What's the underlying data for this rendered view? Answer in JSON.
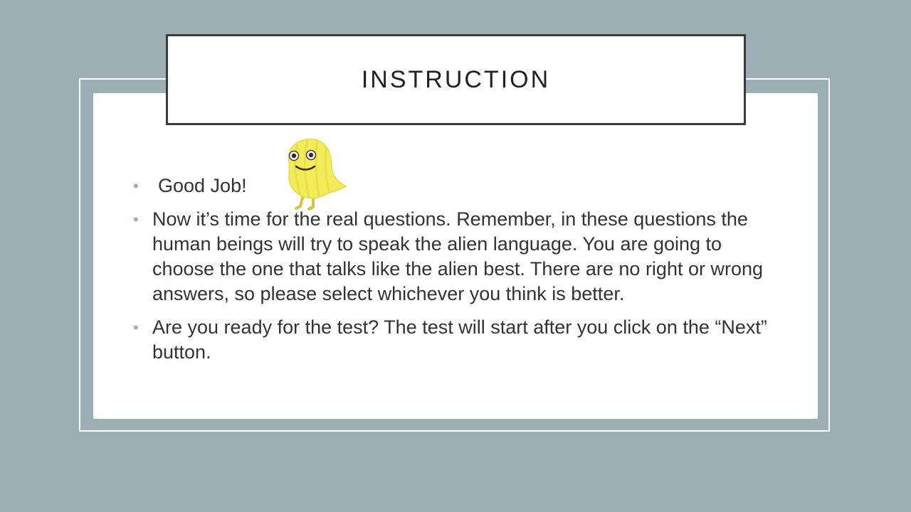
{
  "slide": {
    "title": "INSTRUCTION",
    "bullets": [
      " Good Job!",
      "Now it’s time for the real questions. Remember, in these questions the human beings will try to speak the alien language. You are going to choose the one that talks like the alien best.  There are no right or wrong answers, so please select whichever you think is better.",
      "Are you ready for the test? The test will start after you click on the “Next” button."
    ],
    "bullet_symbol": "•",
    "mascot_icon": "yellow-alien-creature-icon"
  },
  "colors": {
    "background": "#9cafb5",
    "panel": "#ffffff",
    "title_border": "#3b3b3b",
    "text": "#333333",
    "bullet": "#9cafb5",
    "mascot": "#f2ec58"
  }
}
